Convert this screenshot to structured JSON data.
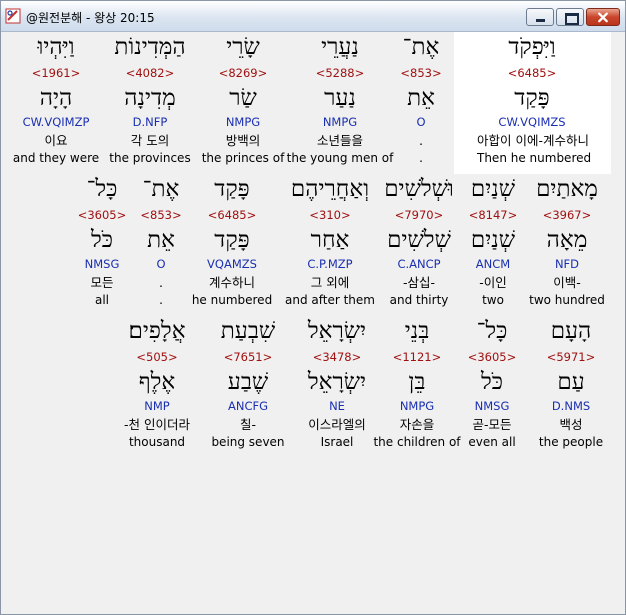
{
  "window": {
    "title": "@원전분해 - 왕상 20:15",
    "colors": {
      "hebrew": "#000000",
      "strong": "#a01010",
      "morph": "#1a2fb0",
      "highlight": "#ffffff"
    }
  },
  "rows": [
    {
      "words": [
        {
          "hebrew": "וַיִּפְקֹד",
          "strong": "<6485>",
          "lemma": "פָּקַד",
          "morph": "CW.VQIMZS",
          "korean": "아합이 이에-계수하니",
          "english": "Then he numbered"
        },
        {
          "hebrew": "אֶת־",
          "strong": "<853>",
          "lemma": "אֵת",
          "morph": "O",
          "korean": ".",
          "english": "."
        },
        {
          "hebrew": "נַעֲרֵי",
          "strong": "<5288>",
          "lemma": "נַעַר",
          "morph": "NMPG",
          "korean": "소년들을",
          "english": "the young men of"
        },
        {
          "hebrew": "שָׂרֵי",
          "strong": "<8269>",
          "lemma": "שַׂר",
          "morph": "NMPG",
          "korean": "방백의",
          "english": "the princes of"
        },
        {
          "hebrew": "הַמְּדִינוֹת",
          "strong": "<4082>",
          "lemma": "מְדִינָה",
          "morph": "D.NFP",
          "korean": "각 도의",
          "english": "the provinces"
        },
        {
          "hebrew": "וַיִּהְיוּ",
          "strong": "<1961>",
          "lemma": "הָיָה",
          "morph": "CW.VQIMZP",
          "korean": "이요",
          "english": "and they were"
        }
      ]
    },
    {
      "words": [
        {
          "hebrew": "מָאתַיִם",
          "strong": "<3967>",
          "lemma": "מֵאָה",
          "morph": "NFD",
          "korean": "이백-",
          "english": "two hundred"
        },
        {
          "hebrew": "שְׁנַיִם",
          "strong": "<8147>",
          "lemma": "שְׁנַיִם",
          "morph": "ANCM",
          "korean": "-이인",
          "english": "two"
        },
        {
          "hebrew": "וּשְׁלֹשִׁים",
          "strong": "<7970>",
          "lemma": "שְׁלֹשִׁים",
          "morph": "C.ANCP",
          "korean": "-삼십-",
          "english": "and thirty"
        },
        {
          "hebrew": "וְאַחֲרֵיהֶם",
          "strong": "<310>",
          "lemma": "אַחַר",
          "morph": "C.P.MZP",
          "korean": "그 외에",
          "english": "and after them"
        },
        {
          "hebrew": "פָּקַד",
          "strong": "<6485>",
          "lemma": "פָּקַד",
          "morph": "VQAMZS",
          "korean": "계수하니",
          "english": "he numbered"
        },
        {
          "hebrew": "אֶת־",
          "strong": "<853>",
          "lemma": "אֵת",
          "morph": "O",
          "korean": ".",
          "english": "."
        },
        {
          "hebrew": "כָּל־",
          "strong": "<3605>",
          "lemma": "כֹּל",
          "morph": "NMSG",
          "korean": "모든",
          "english": "all"
        }
      ]
    },
    {
      "words": [
        {
          "hebrew": "הָעָם",
          "strong": "<5971>",
          "lemma": "עַם",
          "morph": "D.NMS",
          "korean": "백성",
          "english": "the people"
        },
        {
          "hebrew": "כָּל־",
          "strong": "<3605>",
          "lemma": "כֹּל",
          "morph": "NMSG",
          "korean": "곧-모든",
          "english": "even all"
        },
        {
          "hebrew": "בְּנֵי",
          "strong": "<1121>",
          "lemma": "בֵּן",
          "morph": "NMPG",
          "korean": "자손을",
          "english": "the children of"
        },
        {
          "hebrew": "יִשְׂרָאֵל",
          "strong": "<3478>",
          "lemma": "יִשְׂרָאֵל",
          "morph": "NE",
          "korean": "이스라엘의",
          "english": "Israel"
        },
        {
          "hebrew": "שִׁבְעַת",
          "strong": "<7651>",
          "lemma": "שֶׁבַע",
          "morph": "ANCFG",
          "korean": "칠-",
          "english": "being seven"
        },
        {
          "hebrew": "אֲלָפִים׃",
          "strong": "<505>",
          "lemma": "אֶלֶף",
          "morph": "NMP",
          "korean": "-천 인이더라",
          "english": "thousand"
        }
      ]
    }
  ]
}
